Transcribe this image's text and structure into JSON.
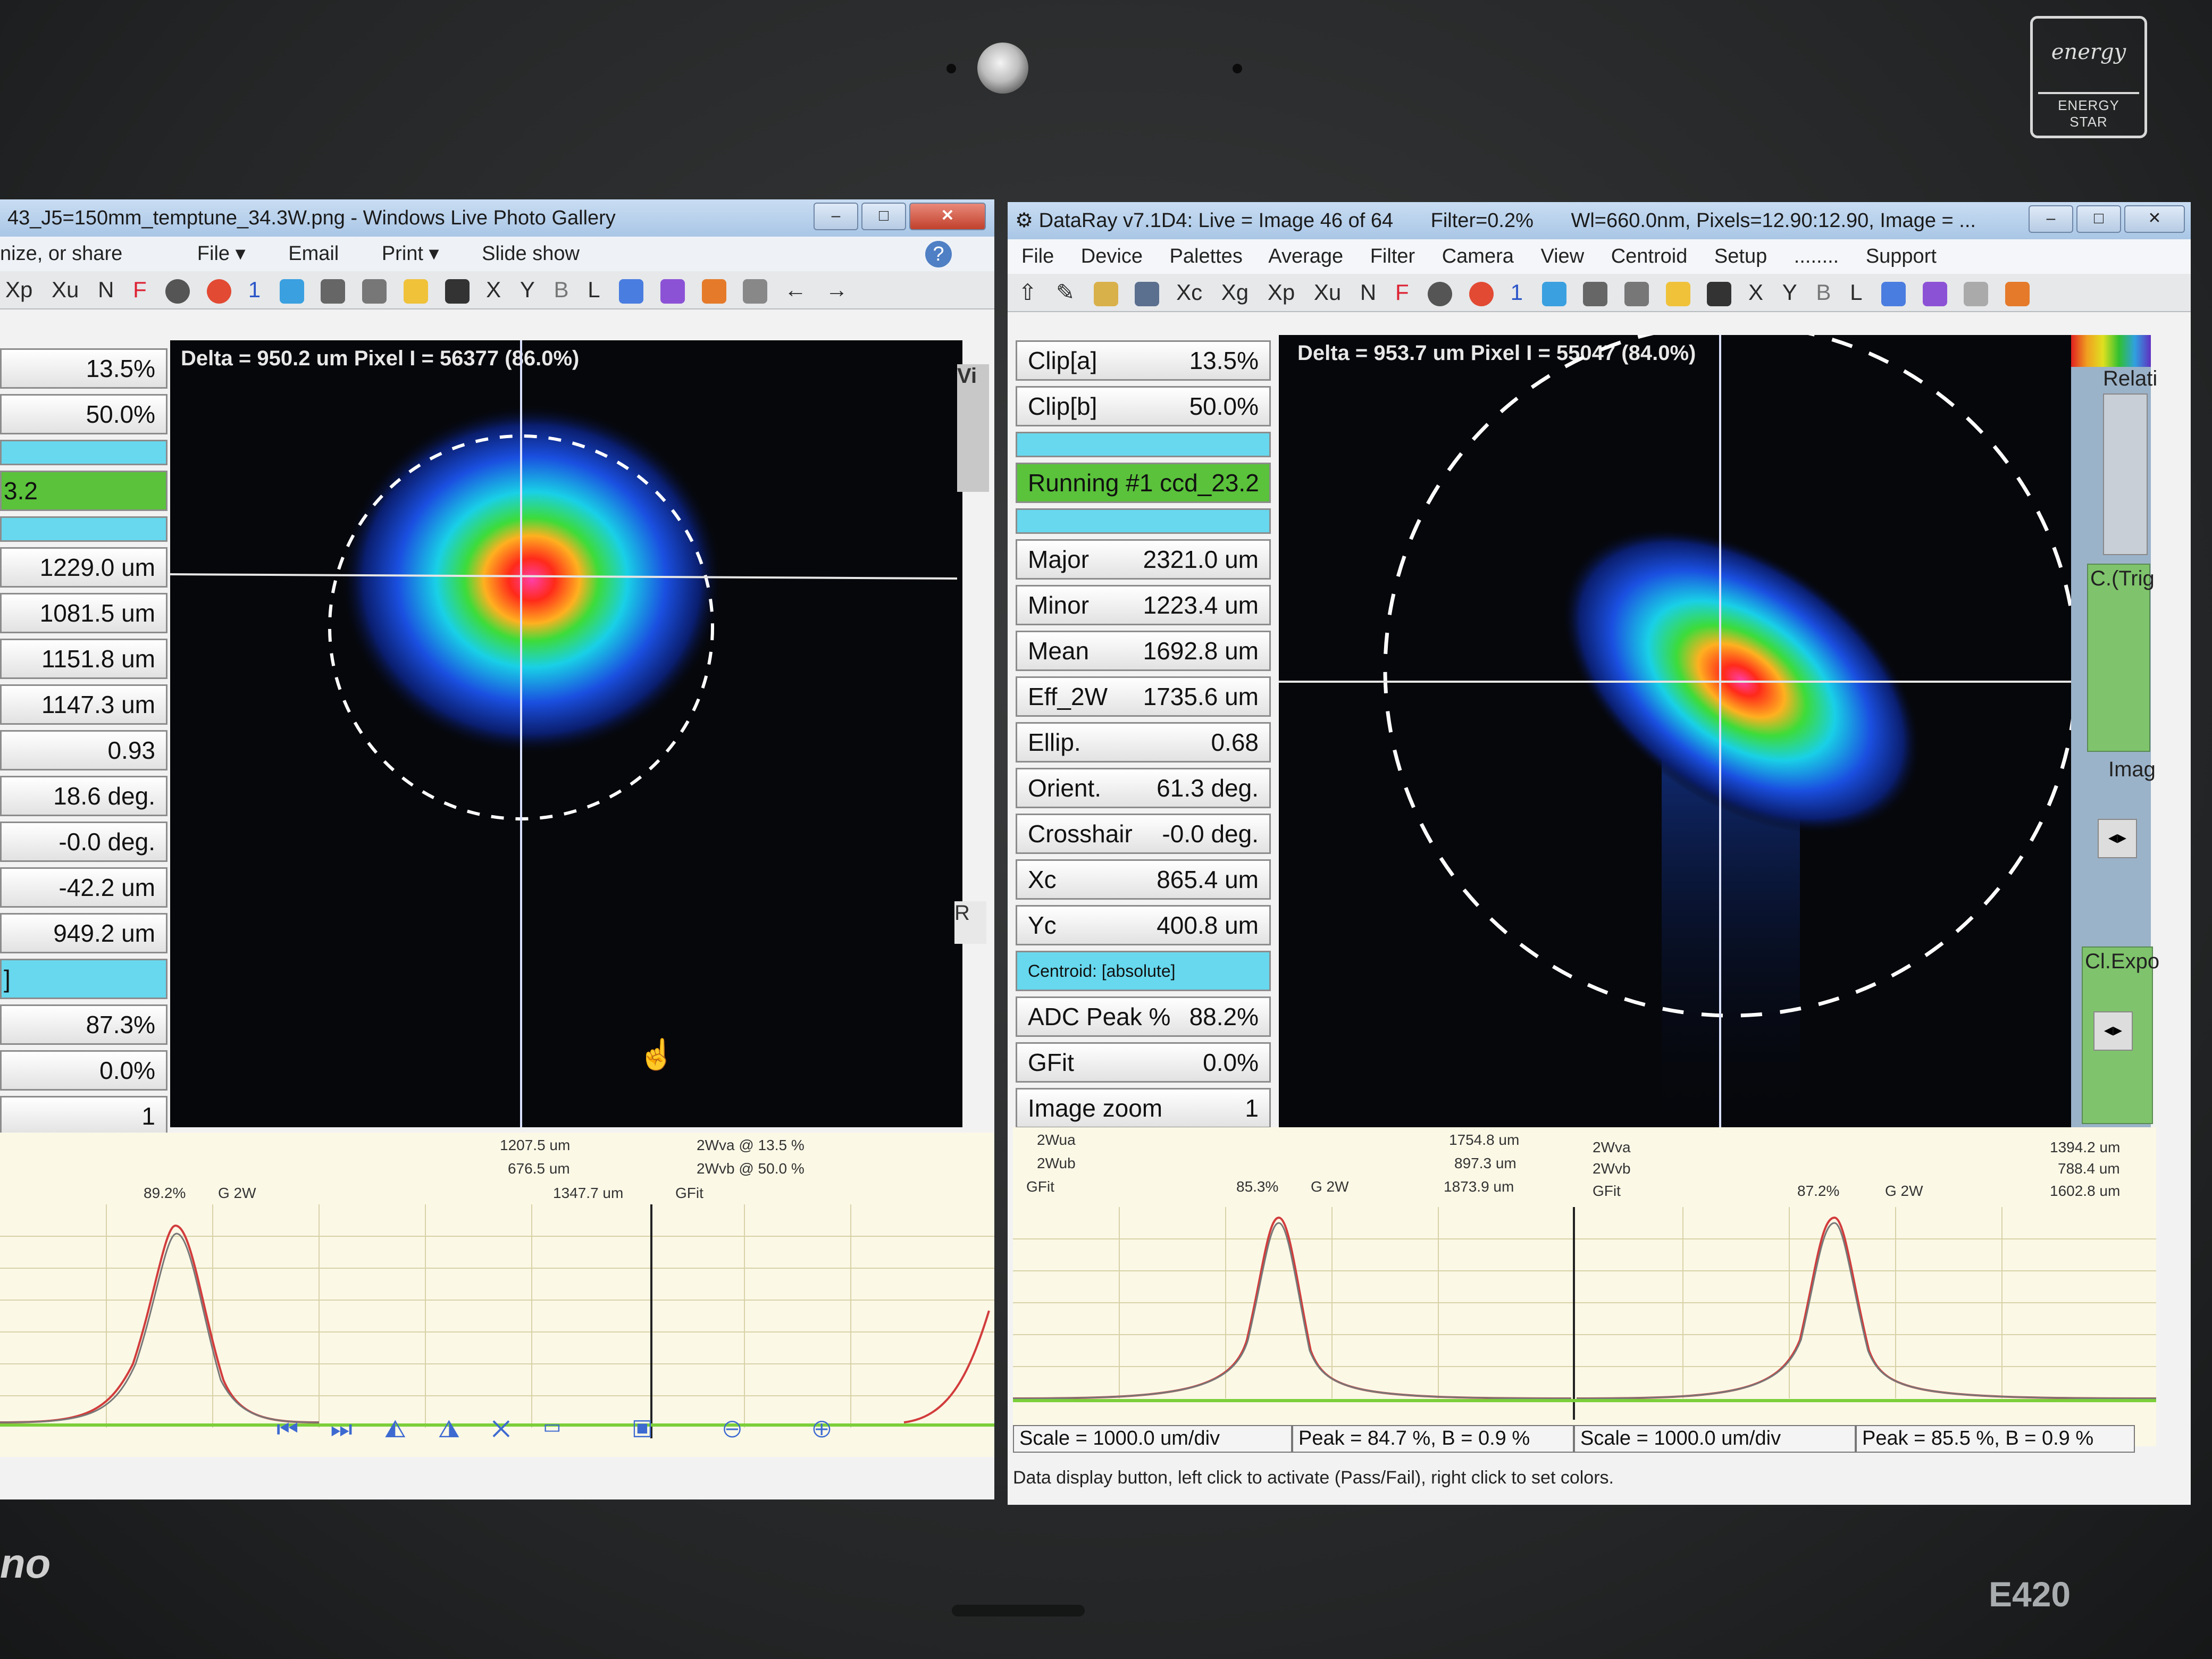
{
  "bezel": {
    "badge_logo": "energy",
    "badge_text": "ENERGY STAR",
    "brand": "no",
    "model": "E420"
  },
  "left_window": {
    "title": "43_J5=150mm_temptune_34.3W.png - Windows Live Photo Gallery",
    "menu": [
      "nize, or share",
      "File ▾",
      "Email",
      "Print ▾",
      "Slide show"
    ],
    "help_icon": "?",
    "toolbar": [
      "Xp",
      "Xu",
      "N",
      "F",
      "1",
      "X",
      "Y",
      "B",
      "L"
    ],
    "overlay": "Delta = 950.2 um Pixel I = 56377 (86.0%)",
    "view_tab": "Vi",
    "right_tab": "R",
    "cells": [
      {
        "value": "13.5%",
        "style": "white"
      },
      {
        "value": "50.0%",
        "style": "white"
      },
      {
        "value": "",
        "style": "cyan"
      },
      {
        "value": "3.2",
        "style": "green"
      },
      {
        "value": "",
        "style": "cyan"
      },
      {
        "value": "1229.0 um",
        "style": "white"
      },
      {
        "value": "1081.5 um",
        "style": "white"
      },
      {
        "value": "1151.8 um",
        "style": "white"
      },
      {
        "value": "1147.3 um",
        "style": "white"
      },
      {
        "value": "0.93",
        "style": "white"
      },
      {
        "value": "18.6 deg.",
        "style": "white"
      },
      {
        "value": "-0.0 deg.",
        "style": "white"
      },
      {
        "value": "-42.2 um",
        "style": "white"
      },
      {
        "value": "949.2 um",
        "style": "white"
      },
      {
        "value": "]",
        "style": "cyan"
      },
      {
        "value": "87.3%",
        "style": "white"
      },
      {
        "value": "0.0%",
        "style": "white"
      },
      {
        "value": "1",
        "style": "white"
      }
    ],
    "profile_header": {
      "row1_val": "1207.5 um",
      "row1_right": "2Wva @ 13.5 %",
      "row2_val": "676.5 um",
      "row2_right": "2Wvb @ 50.0 %",
      "row3_peak": "89.2%",
      "row3_g": "G 2W",
      "row3_val": "1347.7 um",
      "row3_right": "GFit"
    }
  },
  "right_window": {
    "title": "DataRay v7.1D4: Live = Image 46 of 64",
    "title_filter": "Filter=0.2%",
    "title_info": "Wl=660.0nm, Pixels=12.90:12.90, Image = ...",
    "menu": [
      "File",
      "Device",
      "Palettes",
      "Average",
      "Filter",
      "Camera",
      "View",
      "Centroid",
      "Setup",
      "........",
      "Support"
    ],
    "toolbar": [
      "Xc",
      "Xg",
      "Xp",
      "Xu",
      "N",
      "F",
      "1",
      "X",
      "Y",
      "B",
      "L"
    ],
    "overlay": "Delta = 953.7 um Pixel I = 55047 (84.0%)",
    "cells": [
      {
        "label": "Clip[a]",
        "value": "13.5%",
        "style": "white"
      },
      {
        "label": "Clip[b]",
        "value": "50.0%",
        "style": "white"
      },
      {
        "label": "",
        "value": "",
        "style": "cyan"
      },
      {
        "label": "Running #1 ccd_23.2",
        "value": "",
        "style": "green"
      },
      {
        "label": "",
        "value": "",
        "style": "cyan"
      },
      {
        "label": "Major",
        "value": "2321.0 um",
        "style": "white"
      },
      {
        "label": "Minor",
        "value": "1223.4 um",
        "style": "white"
      },
      {
        "label": "Mean",
        "value": "1692.8 um",
        "style": "white"
      },
      {
        "label": "Eff_2W",
        "value": "1735.6 um",
        "style": "white"
      },
      {
        "label": "Ellip.",
        "value": "0.68",
        "style": "white"
      },
      {
        "label": "Orient.",
        "value": "61.3 deg.",
        "style": "white"
      },
      {
        "label": "Crosshair",
        "value": "-0.0 deg.",
        "style": "white"
      },
      {
        "label": "Xc",
        "value": "865.4 um",
        "style": "white"
      },
      {
        "label": "Yc",
        "value": "400.8 um",
        "style": "white"
      },
      {
        "label": "Centroid: [absolute]",
        "value": "",
        "style": "cyan"
      },
      {
        "label": "ADC Peak %",
        "value": "88.2%",
        "style": "white"
      },
      {
        "label": "GFit",
        "value": "0.0%",
        "style": "white"
      },
      {
        "label": "Image zoom",
        "value": "1",
        "style": "white"
      }
    ],
    "side_labels": {
      "relative": "Relati",
      "trig": "C.(Trig",
      "imag": "Imag",
      "expo": "Cl.Expo"
    },
    "profile_header": {
      "left": {
        "row1_label": "2Wua",
        "row1_val": "1754.8 um",
        "row2_label": "2Wub",
        "row2_val": "897.3 um",
        "row3_label": "GFit",
        "row3_peak": "85.3%",
        "row3_g": "G 2W",
        "row3_val": "1873.9 um"
      },
      "right": {
        "row1_label": "2Wva",
        "row1_val": "1394.2 um",
        "row2_label": "2Wvb",
        "row2_val": "788.4 um",
        "row3_label": "GFit",
        "row3_peak": "87.2%",
        "row3_g": "G 2W",
        "row3_val": "1602.8 um"
      }
    },
    "status": {
      "scale_left": "Scale = 1000.0 um/div",
      "peak_left": "Peak = 84.7 %, B = 0.9 %",
      "scale_right": "Scale = 1000.0 um/div",
      "peak_right": "Peak = 85.5 %, B = 0.9 %",
      "hint": "Data display button, left click to activate (Pass/Fail), right click to set colors."
    }
  }
}
